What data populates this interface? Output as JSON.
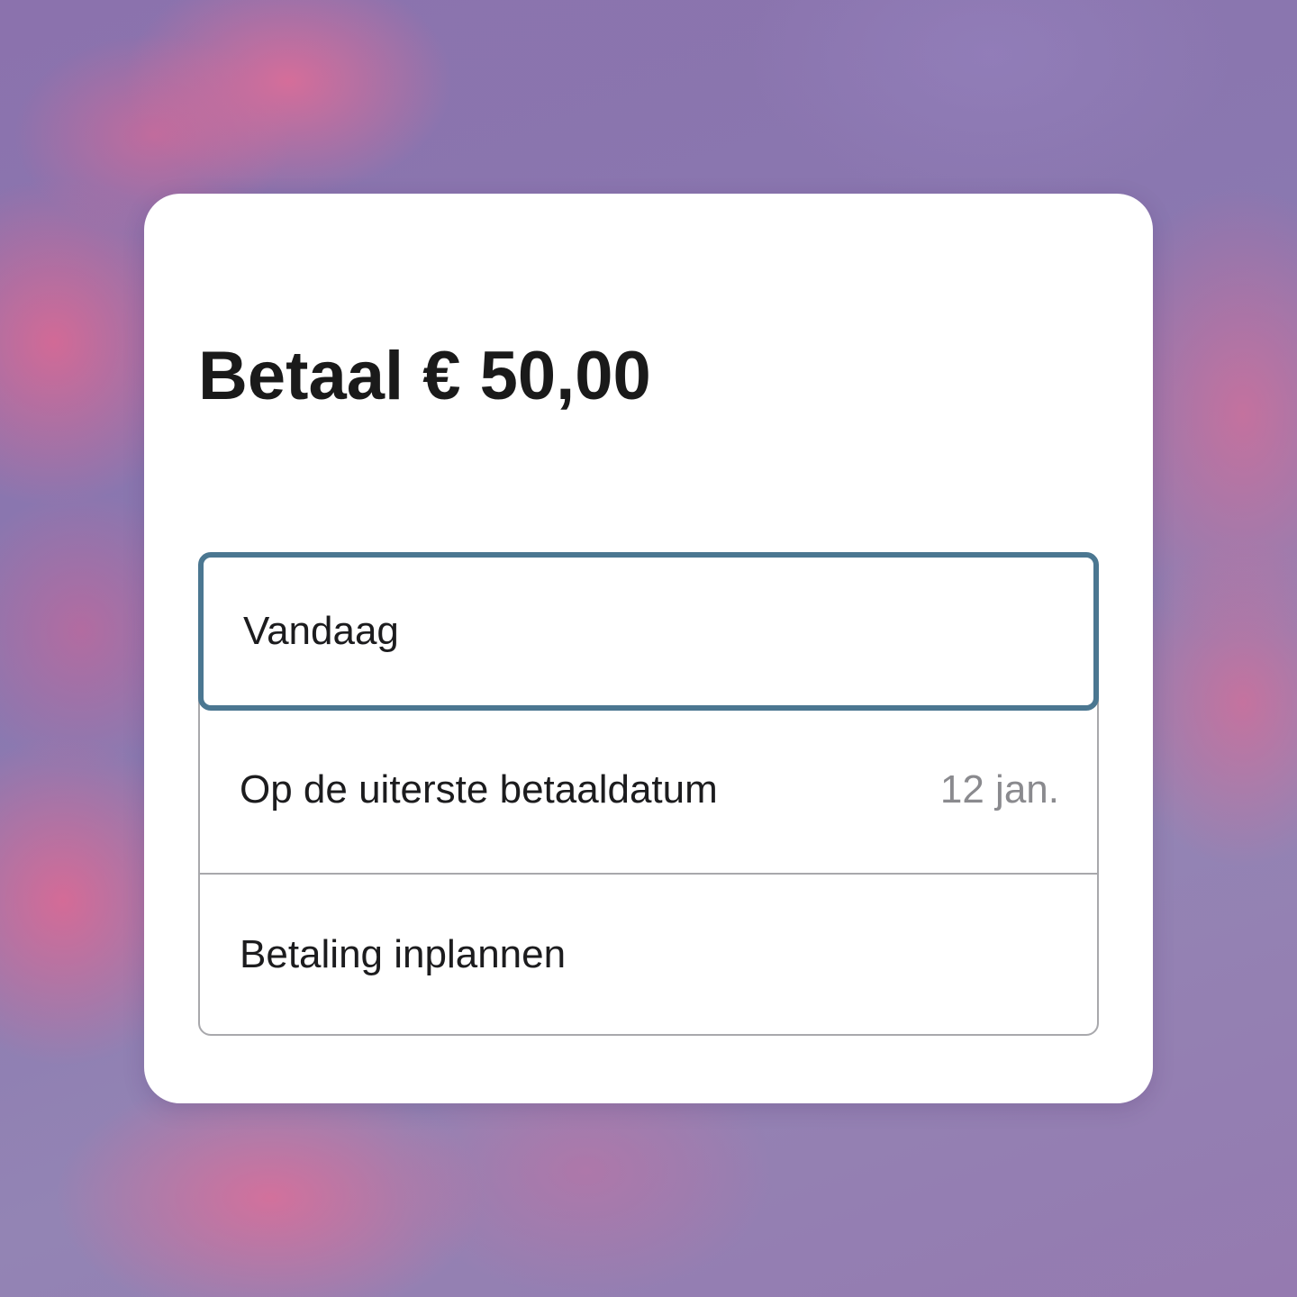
{
  "payment": {
    "title": "Betaal € 50,00",
    "options": [
      {
        "label": "Vandaag",
        "meta": "",
        "selected": true
      },
      {
        "label": "Op de uiterste betaaldatum",
        "meta": "12 jan.",
        "selected": false
      },
      {
        "label": "Betaling inplannen",
        "meta": "",
        "selected": false
      }
    ]
  },
  "colors": {
    "selected_border": "#4b7791",
    "card_background": "#ffffff",
    "muted_text": "#8a8a8e"
  }
}
